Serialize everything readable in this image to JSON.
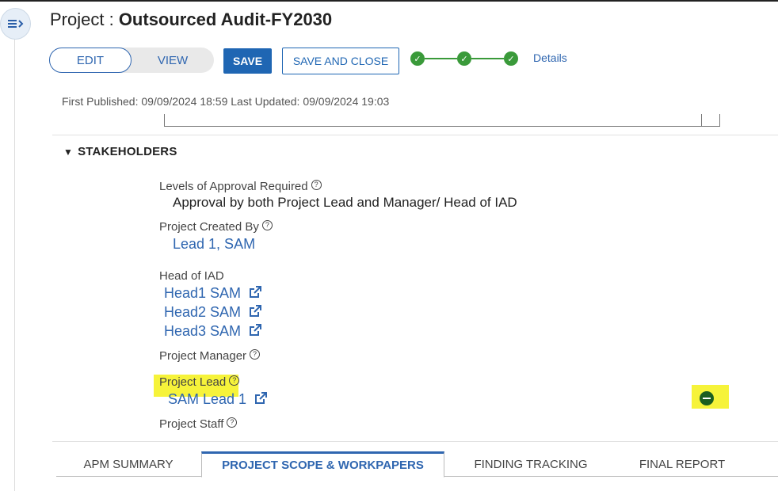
{
  "header": {
    "title_prefix": "Project : ",
    "title_name": "Outsourced Audit-FY2030"
  },
  "toolbar": {
    "edit_label": "EDIT",
    "view_label": "VIEW",
    "save_label": "SAVE",
    "save_close_label": "SAVE AND CLOSE",
    "details_label": "Details"
  },
  "progress": {
    "steps_completed": 3,
    "steps_total": 3
  },
  "meta": {
    "text": "First Published: 09/09/2024 18:59 Last Updated: 09/09/2024 19:03"
  },
  "stakeholders": {
    "section_title": "STAKEHOLDERS",
    "levels_label": "Levels of Approval Required",
    "levels_value": "Approval by both Project Lead and Manager/ Head of IAD",
    "created_by_label": "Project Created By",
    "created_by_value": "Lead 1, SAM",
    "head_label": "Head of IAD",
    "heads": [
      "Head1 SAM",
      "Head2 SAM",
      "Head3 SAM"
    ],
    "manager_label": "Project Manager",
    "lead_label": "Project Lead",
    "lead_value": "SAM Lead 1",
    "staff_label": "Project Staff"
  },
  "tabs": [
    "APM SUMMARY",
    "PROJECT SCOPE & WORKPAPERS",
    "FINDING TRACKING",
    "FINAL REPORT"
  ],
  "colors": {
    "accent": "#1f66b3",
    "success": "#3a9a3a",
    "highlight": "#f6f33a"
  }
}
